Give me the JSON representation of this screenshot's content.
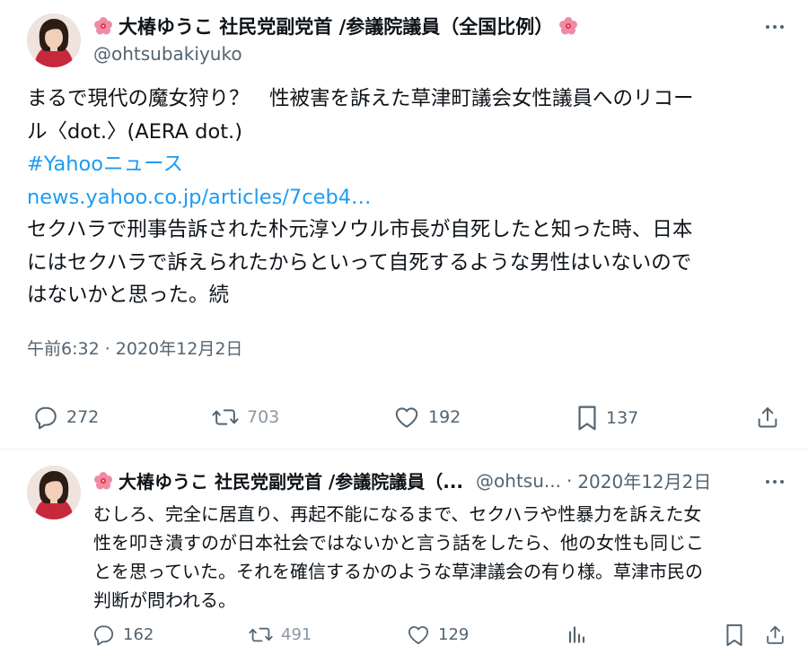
{
  "main_post": {
    "display_name": "大椿ゆうこ 社民党副党首 /参議院議員（全国比例）",
    "handle": "@ohtsubakiyuko",
    "text_lines": [
      "まるで現代の魔女狩り？　性被害を訴えた草津町議会女性議員へのリコー",
      "ル〈dot.〉(AERA dot.)"
    ],
    "hashtag": "#Yahooニュース",
    "link": "news.yahoo.co.jp/articles/7ceb4…",
    "body_lines": [
      "セクハラで刑事告訴された朴元淳ソウル市長が自死したと知った時、日本",
      "にはセクハラで訴えられたからといって自死するような男性はいないので",
      "はないかと思った。続"
    ],
    "timestamp": "午前6:32 · 2020年12月2日",
    "actions": {
      "replies": "272",
      "reposts": "703",
      "likes": "192",
      "bookmarks": "137"
    }
  },
  "reply_post": {
    "display_name": "大椿ゆうこ 社民党副党首 /参議院議員（...",
    "handle": "@ohtsu...",
    "separator": "·",
    "date": "2020年12月2日",
    "text_lines": [
      "むしろ、完全に居直り、再起不能になるまで、セクハラや性暴力を訴えた女",
      "性を叩き潰すのが日本社会ではないかと言う話をしたら、他の女性も同じこ",
      "とを思っていた。それを確信するかのような草津議会の有り様。草津市民の",
      "判断が問われる。"
    ],
    "actions": {
      "replies": "162",
      "reposts": "491",
      "likes": "129"
    }
  },
  "icons": {
    "flower": "hibiscus-emoji",
    "reply": "speech-bubble-icon",
    "repost": "retweet-icon",
    "like": "heart-icon",
    "bookmark": "bookmark-icon",
    "share": "share-upload-icon",
    "views": "bar-chart-icon",
    "more": "ellipsis-icon"
  },
  "colors": {
    "text": "#0f1419",
    "secondary": "#536471",
    "link": "#1d9bf0",
    "flower": "#f08aa6"
  }
}
